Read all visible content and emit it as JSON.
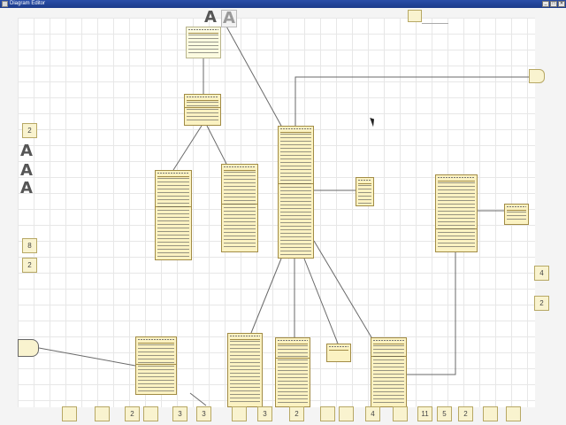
{
  "window": {
    "title": "Diagram Editor",
    "controls": [
      "_",
      "□",
      "✕"
    ]
  },
  "toolbar": {
    "text_icon_large": "A",
    "text_icon_small": "A"
  },
  "left_palette": [
    {
      "name": "badge-2",
      "label": "2"
    },
    {
      "name": "letter-a-1",
      "label": "A"
    },
    {
      "name": "letter-a-2",
      "label": "A"
    },
    {
      "name": "letter-a-3",
      "label": "A"
    },
    {
      "name": "badge-8",
      "label": "8"
    },
    {
      "name": "badge-2b",
      "label": "2"
    }
  ],
  "right_palette": [
    {
      "name": "badge-4",
      "label": "4"
    },
    {
      "name": "badge-2r",
      "label": "2"
    }
  ],
  "bottom_tray": [
    {
      "label": ""
    },
    {
      "label": ""
    },
    {
      "label": "2"
    },
    {
      "label": ""
    },
    {
      "label": "3"
    },
    {
      "label": "3"
    },
    {
      "label": ""
    },
    {
      "label": "3"
    },
    {
      "label": "2"
    },
    {
      "label": ""
    },
    {
      "label": ""
    },
    {
      "label": "4"
    },
    {
      "label": ""
    },
    {
      "label": "11"
    },
    {
      "label": "5"
    },
    {
      "label": "2"
    },
    {
      "label": ""
    },
    {
      "label": ""
    }
  ],
  "classes": [
    {
      "id": "top-class"
    },
    {
      "id": "mid-left-class"
    },
    {
      "id": "left-class-a"
    },
    {
      "id": "left-class-b"
    },
    {
      "id": "center-class"
    },
    {
      "id": "small-class"
    },
    {
      "id": "right-class"
    },
    {
      "id": "far-right-class"
    },
    {
      "id": "bottom-class-1"
    },
    {
      "id": "bottom-class-2"
    },
    {
      "id": "bottom-class-3"
    },
    {
      "id": "bottom-class-4"
    },
    {
      "id": "bottom-class-5"
    }
  ]
}
